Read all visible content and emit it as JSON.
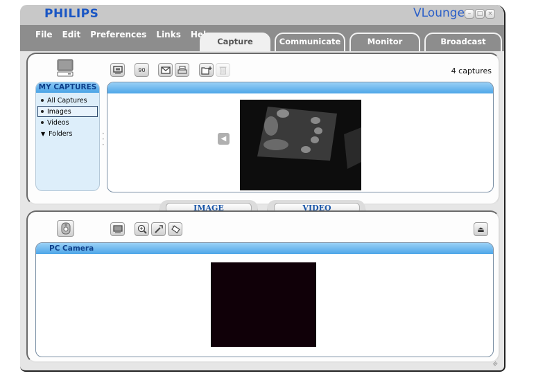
{
  "window": {
    "brand": "PHILIPS",
    "app_name": "VLounge",
    "controls": {
      "minimize": "–",
      "maximize": "□",
      "close": "×"
    }
  },
  "menu": [
    "File",
    "Edit",
    "Preferences",
    "Links",
    "Help"
  ],
  "tabs": [
    {
      "label": "Capture",
      "active": true
    },
    {
      "label": "Communicate",
      "active": false
    },
    {
      "label": "Monitor",
      "active": false
    },
    {
      "label": "Broadcast",
      "active": false
    }
  ],
  "captures_panel": {
    "icon": "computer-icon",
    "toolbar": [
      {
        "name": "slideshow-icon",
        "glyph": "▣"
      },
      {
        "name": "rotate-90-icon",
        "glyph": "90"
      },
      {
        "name": "email-icon",
        "glyph": "✉"
      },
      {
        "name": "print-icon",
        "glyph": "⎙"
      },
      {
        "name": "new-folder-icon",
        "glyph": "+"
      },
      {
        "name": "trash-icon",
        "glyph": "🗑",
        "disabled": true
      }
    ],
    "count_text": "4 captures",
    "sidebar": {
      "title": "MY CAPTURES",
      "items": [
        {
          "label": "All Captures",
          "marker": "bullet",
          "selected": false
        },
        {
          "label": "Images",
          "marker": "bullet",
          "selected": true
        },
        {
          "label": "Videos",
          "marker": "bullet",
          "selected": false
        },
        {
          "label": "Folders",
          "marker": "triangle",
          "selected": false
        }
      ]
    },
    "nav_prev": "◀"
  },
  "mode_switch": {
    "image_label": "IMAGE",
    "video_label": "VIDEO"
  },
  "camera_panel": {
    "icon": "webcam-icon",
    "toolbar": [
      {
        "name": "monitor-icon",
        "glyph": "▭"
      },
      {
        "name": "zoom-icon",
        "glyph": "⊕"
      },
      {
        "name": "settings-wrench-icon",
        "glyph": "✎"
      },
      {
        "name": "snapshot-icon",
        "glyph": "◇"
      }
    ],
    "eject_glyph": "⏏",
    "viewer_title": "PC Camera"
  },
  "colors": {
    "brand_blue": "#1a56c4",
    "header_blue": "#4ea6e8",
    "chrome_gray": "#8d8d8d"
  }
}
